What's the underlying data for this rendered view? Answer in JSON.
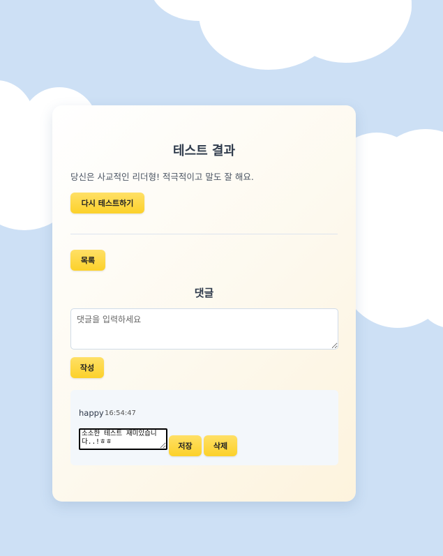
{
  "result": {
    "title": "테스트 결과",
    "description": "당신은 사교적인 리더형! 적극적이고 말도 잘 해요.",
    "retry_label": "다시 테스트하기"
  },
  "nav": {
    "list_label": "목록"
  },
  "comments": {
    "heading": "댓글",
    "input_placeholder": "댓글을 입력하세요",
    "submit_label": "작성",
    "items": [
      {
        "author": "happy",
        "time": "16:54:47",
        "text": "소소한 테스트 재미있습니다..!ㅎㅎ",
        "save_label": "저장",
        "delete_label": "삭제"
      }
    ]
  },
  "colors": {
    "sky": "#cde0f5",
    "button": "#fcd12a",
    "card": "#fdf9ee"
  }
}
